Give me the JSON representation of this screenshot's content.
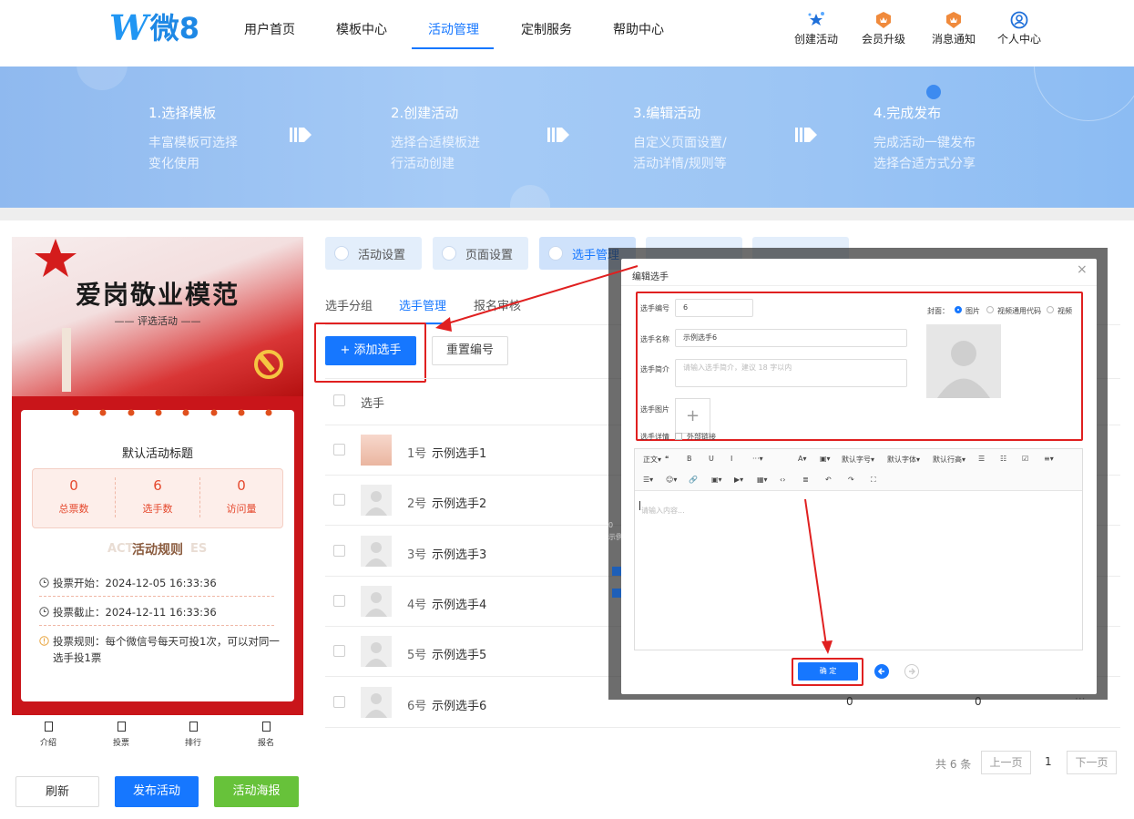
{
  "header": {
    "logo_w": "W",
    "logo_text": "微8",
    "nav": [
      "用户首页",
      "模板中心",
      "活动管理",
      "定制服务",
      "帮助中心"
    ],
    "actions": [
      {
        "label": "创建活动",
        "icon": "star-cluster-icon"
      },
      {
        "label": "会员升级",
        "icon": "crown-badge-icon"
      },
      {
        "label": "消息通知",
        "icon": "bell-badge-icon"
      },
      {
        "label": "个人中心",
        "icon": "user-circle-icon"
      }
    ]
  },
  "banner": {
    "steps": [
      {
        "title": "1.选择模板",
        "l1": "丰富模板可选择",
        "l2": "变化使用"
      },
      {
        "title": "2.创建活动",
        "l1": "选择合适模板进",
        "l2": "行活动创建"
      },
      {
        "title": "3.编辑活动",
        "l1": "自定义页面设置/",
        "l2": "活动详情/规则等"
      },
      {
        "title": "4.完成发布",
        "l1": "完成活动一键发布",
        "l2": "选择合适方式分享"
      }
    ]
  },
  "preview": {
    "poster_title": "爱岗敬业模范",
    "poster_sub": "—— 评选活动 ——",
    "activity_title": "默认活动标题",
    "stats": [
      {
        "value": "0",
        "label": "总票数"
      },
      {
        "value": "6",
        "label": "选手数"
      },
      {
        "value": "0",
        "label": "访问量"
      }
    ],
    "rules_bg": "ACT",
    "rules_bg_tail": "ES",
    "rules_title": "活动规则",
    "vote_start": "投票开始：2024-12-05 16:33:36",
    "vote_end": "投票截止：2024-12-11 16:33:36",
    "vote_rule": "投票规则：每个微信号每天可投1次，可以对同一选手投1票",
    "bottom_nav": [
      "介绍",
      "投票",
      "排行",
      "报名"
    ]
  },
  "actions": {
    "refresh": "刷新",
    "publish": "发布活动",
    "poster": "活动海报"
  },
  "config_tabs": [
    "活动设置",
    "页面设置",
    "选手管理"
  ],
  "sub_tabs": [
    "选手分组",
    "选手管理",
    "报名审核"
  ],
  "toolbar": {
    "add": "+ 添加选手",
    "reset": "重置编号"
  },
  "table": {
    "col_player": "选手",
    "rows": [
      {
        "no": "1号",
        "name": "示例选手1"
      },
      {
        "no": "2号",
        "name": "示例选手2"
      },
      {
        "no": "3号",
        "name": "示例选手3"
      },
      {
        "no": "4号",
        "name": "示例选手4"
      },
      {
        "no": "5号",
        "name": "示例选手5"
      },
      {
        "no": "6号",
        "name": "示例选手6"
      }
    ],
    "row6_votes": "0",
    "row6_visits": "0",
    "row6_more": "···"
  },
  "pagination": {
    "total": "共 6 条",
    "prev": "上一页",
    "page": "1",
    "next": "下一页"
  },
  "modal": {
    "title": "编辑选手",
    "close": "×",
    "no_label": "选手编号",
    "no_value": "6",
    "name_label": "选手名称",
    "name_value": "示例选手6",
    "intro_label": "选手简介",
    "intro_placeholder": "请输入选手简介，建议 18 字以内",
    "image_label": "选手图片",
    "image_add": "+",
    "detail_label": "选手详情",
    "external_link": "外部链接",
    "cover_label": "封面：",
    "cover_options": [
      "图片",
      "视频通用代码",
      "视频"
    ],
    "editor_tools_1": [
      "正文▾",
      "❝",
      "B",
      "U",
      "I",
      "···▾",
      "A▾",
      "▣▾",
      "默认字号▾",
      "默认字体▾",
      "默认行高▾",
      "☰",
      "☷",
      "☑",
      "≡▾"
    ],
    "editor_tools_2": [
      "☰▾",
      "☺▾",
      "🔗",
      "▣▾",
      "▶▾",
      "▦▾",
      "‹›",
      "≣",
      "↶",
      "↷",
      "⛶"
    ],
    "editor_placeholder": "请输入内容...",
    "confirm": "确 定"
  },
  "overlay_bits": {
    "a": "0",
    "b": "示例"
  },
  "colors": {
    "primary": "#1677ff",
    "green": "#67c23a",
    "red": "#e02020",
    "poster_red": "#c9151a"
  }
}
